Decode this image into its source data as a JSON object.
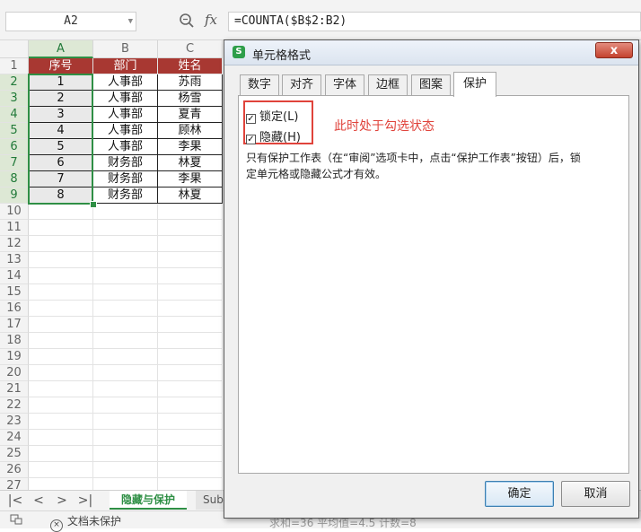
{
  "formula_bar": {
    "name_box": "A2",
    "fx": "fx",
    "formula": "=COUNTA($B$2:B2)"
  },
  "sheet": {
    "columns": [
      "A",
      "B",
      "C"
    ],
    "rows": [
      "1",
      "2",
      "3",
      "4",
      "5",
      "6",
      "7",
      "8",
      "9",
      "10",
      "11",
      "12",
      "13",
      "14",
      "15",
      "16",
      "17",
      "18",
      "19",
      "20",
      "21",
      "22",
      "23",
      "24",
      "25",
      "26",
      "27"
    ],
    "header_row": [
      "序号",
      "部门",
      "姓名"
    ],
    "data": [
      [
        "1",
        "人事部",
        "苏雨"
      ],
      [
        "2",
        "人事部",
        "杨雪"
      ],
      [
        "3",
        "人事部",
        "夏青"
      ],
      [
        "4",
        "人事部",
        "顾林"
      ],
      [
        "5",
        "人事部",
        "李果"
      ],
      [
        "6",
        "财务部",
        "林夏"
      ],
      [
        "7",
        "财务部",
        "李果"
      ],
      [
        "8",
        "财务部",
        "林夏"
      ]
    ],
    "header_color": "#a83832",
    "selection_color": "#2f8f45"
  },
  "sheet_tabs": {
    "nav": [
      "|<",
      "<",
      ">",
      ">|"
    ],
    "active": "隐藏与保护",
    "next": "Sub"
  },
  "status_bar": {
    "protect_text": "文档未保护",
    "summary": "求和=36  平均值=4.5  计数=8"
  },
  "dialog": {
    "title": "单元格格式",
    "close": "x",
    "tabs": [
      "数字",
      "对齐",
      "字体",
      "边框",
      "图案",
      "保护"
    ],
    "active_tab": "保护",
    "locked_label": "锁定(L)",
    "hidden_label": "隐藏(H)",
    "locked_checked": true,
    "hidden_checked": true,
    "annotation": "此时处于勾选状态",
    "annotation_color": "#e0433b",
    "help_line1": "只有保护工作表（在“审阅”选项卡中，点击“保护工作表”按钮）后，锁",
    "help_line2": "定单元格或隐藏公式才有效。",
    "ok": "确定",
    "cancel": "取消"
  }
}
